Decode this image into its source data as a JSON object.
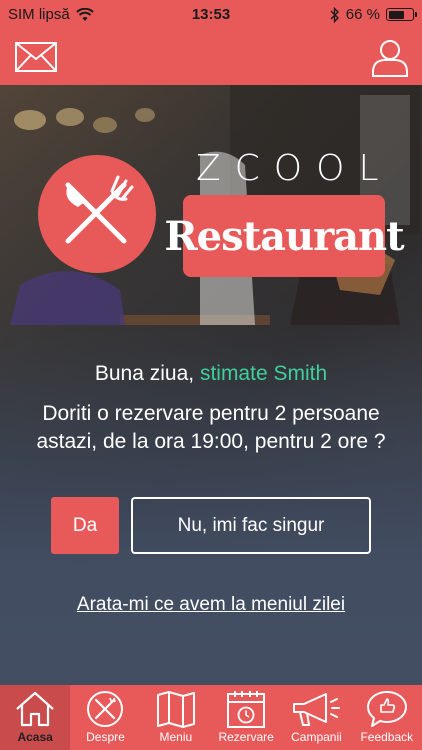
{
  "status_bar": {
    "carrier": "SIM lipsă",
    "time": "13:53",
    "battery_text": "66 %",
    "battery_level": 0.66
  },
  "nav": {
    "mail_icon": "mail-icon",
    "user_icon": "user-icon"
  },
  "brand": {
    "name_top": "ZCOOL",
    "name_bottom": "Restaurant",
    "accent": "#e85a5a",
    "highlight": "#3ecf9b"
  },
  "main": {
    "greeting_prefix": "Buna ziua, ",
    "greeting_name": "stimate Smith",
    "question": "Doriti o rezervare pentru 2 persoane astazi, de la ora 19:00, pentru 2 ore ?",
    "yes_label": "Da",
    "no_label": "Nu, imi fac singur",
    "menu_link": "Arata-mi ce avem la meniul zilei"
  },
  "tabs": [
    {
      "label": "Acasa",
      "icon": "home-icon",
      "active": true
    },
    {
      "label": "Despre",
      "icon": "cutlery-icon",
      "active": false
    },
    {
      "label": "Meniu",
      "icon": "map-icon",
      "active": false
    },
    {
      "label": "Rezervare",
      "icon": "calendar-icon",
      "active": false
    },
    {
      "label": "Campanii",
      "icon": "megaphone-icon",
      "active": false
    },
    {
      "label": "Feedback",
      "icon": "chat-icon",
      "active": false
    }
  ]
}
